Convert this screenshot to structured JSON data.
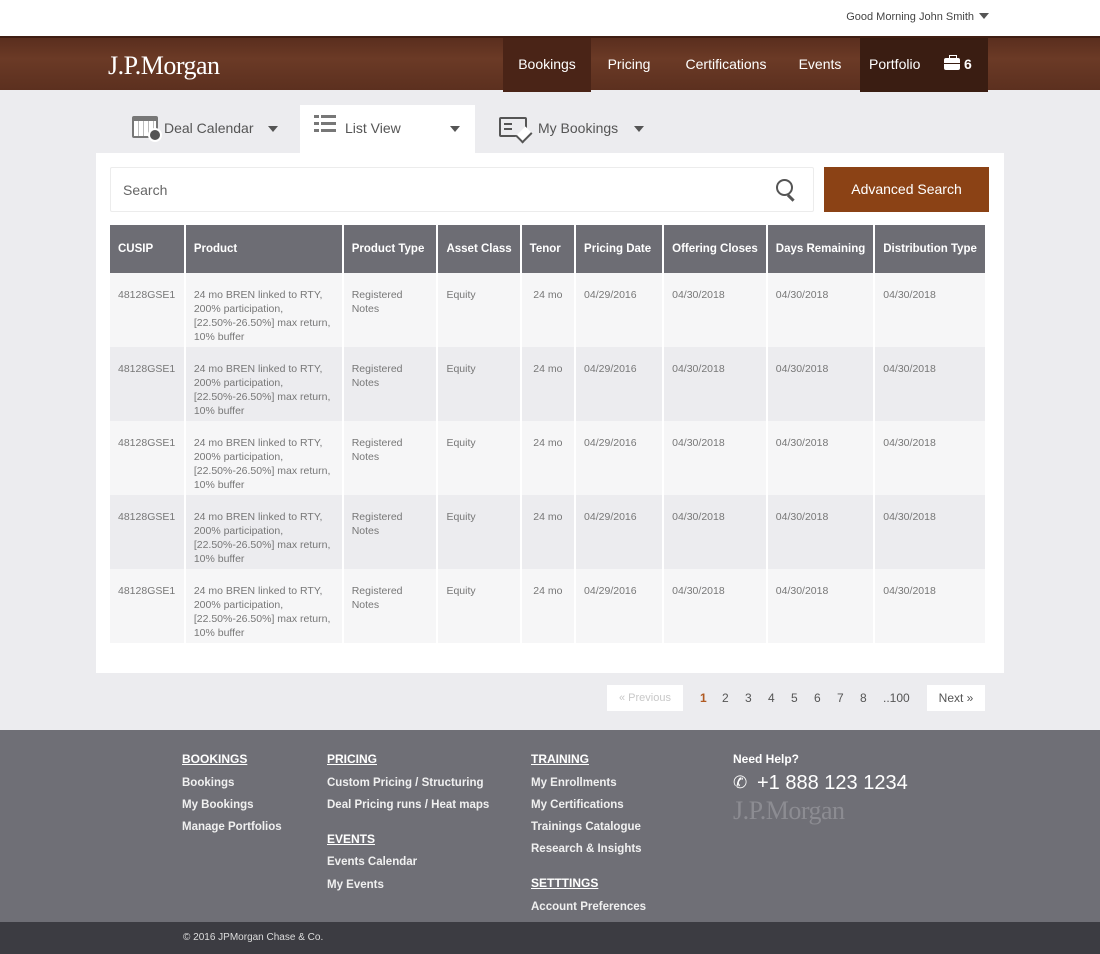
{
  "header": {
    "greeting": "Good Morning John Smith",
    "logo": "J.P.Morgan",
    "nav": [
      {
        "label": "Bookings"
      },
      {
        "label": "Pricing"
      },
      {
        "label": "Certifications"
      },
      {
        "label": "Events"
      }
    ],
    "portfolio": {
      "label": "Portfolio",
      "count": "6"
    }
  },
  "tabs": [
    {
      "label": "Deal Calendar",
      "icon": "calendar-icon"
    },
    {
      "label": "List View",
      "icon": "list-icon"
    },
    {
      "label": "My Bookings",
      "icon": "bookings-check-icon"
    }
  ],
  "search": {
    "placeholder": "Search",
    "value": "",
    "advanced_label": "Advanced Search"
  },
  "table": {
    "columns": [
      "CUSIP",
      "Product",
      "Product Type",
      "Asset Class",
      "Tenor",
      "Pricing Date",
      "Offering Closes",
      "Days Remaining",
      "Distribution Type"
    ],
    "rows": [
      {
        "cusip": "48128GSE1",
        "product": "24 mo BREN linked to RTY, 200% participation, [22.50%-26.50%] max return, 10% buffer",
        "product_type": "Registered Notes",
        "asset_class": "Equity",
        "tenor": "24 mo",
        "pricing_date": "04/29/2016",
        "offering_closes": "04/30/2018",
        "days_remaining": "04/30/2018",
        "distribution_type": "04/30/2018"
      },
      {
        "cusip": "48128GSE1",
        "product": "24 mo BREN linked to RTY, 200% participation, [22.50%-26.50%] max return, 10% buffer",
        "product_type": "Registered Notes",
        "asset_class": "Equity",
        "tenor": "24 mo",
        "pricing_date": "04/29/2016",
        "offering_closes": "04/30/2018",
        "days_remaining": "04/30/2018",
        "distribution_type": "04/30/2018"
      },
      {
        "cusip": "48128GSE1",
        "product": "24 mo BREN linked to RTY, 200% participation, [22.50%-26.50%] max return, 10% buffer",
        "product_type": "Registered Notes",
        "asset_class": "Equity",
        "tenor": "24 mo",
        "pricing_date": "04/29/2016",
        "offering_closes": "04/30/2018",
        "days_remaining": "04/30/2018",
        "distribution_type": "04/30/2018"
      },
      {
        "cusip": "48128GSE1",
        "product": "24 mo BREN linked to RTY, 200% participation, [22.50%-26.50%] max return, 10% buffer",
        "product_type": "Registered Notes",
        "asset_class": "Equity",
        "tenor": "24 mo",
        "pricing_date": "04/29/2016",
        "offering_closes": "04/30/2018",
        "days_remaining": "04/30/2018",
        "distribution_type": "04/30/2018"
      },
      {
        "cusip": "48128GSE1",
        "product": "24 mo BREN linked to RTY, 200% participation, [22.50%-26.50%] max return, 10% buffer",
        "product_type": "Registered Notes",
        "asset_class": "Equity",
        "tenor": "24 mo",
        "pricing_date": "04/29/2016",
        "offering_closes": "04/30/2018",
        "days_remaining": "04/30/2018",
        "distribution_type": "04/30/2018"
      }
    ]
  },
  "pagination": {
    "previous": "« Previous",
    "pages": [
      "1",
      "2",
      "3",
      "4",
      "5",
      "6",
      "7",
      "8",
      "..100"
    ],
    "current": "1",
    "next": "Next »"
  },
  "footer": {
    "bookings": {
      "heading": "BOOKINGS",
      "links": [
        "Bookings",
        "My Bookings",
        "Manage Portfolios"
      ]
    },
    "pricing": {
      "heading": "PRICING",
      "links": [
        "Custom Pricing / Structuring",
        "Deal Pricing runs / Heat maps"
      ]
    },
    "events": {
      "heading": "EVENTS",
      "links": [
        "Events Calendar",
        "My Events"
      ]
    },
    "training": {
      "heading": "TRAINING",
      "links": [
        "My Enrollments",
        "My Certifications",
        "Trainings Catalogue",
        "Research & Insights"
      ]
    },
    "settings": {
      "heading": "SETTTINGS",
      "links": [
        "Account Preferences"
      ]
    },
    "help": {
      "label": "Need Help?",
      "phone": "+1 888 123 1234",
      "logo": "J.P.Morgan"
    },
    "copyright": "© 2016 JPMorgan Chase & Co."
  },
  "colors": {
    "brand_brown": "#5a2e1e",
    "accent_orange": "#8b4215",
    "table_header": "#6d6d74",
    "footer_bg": "#6f6f76"
  }
}
